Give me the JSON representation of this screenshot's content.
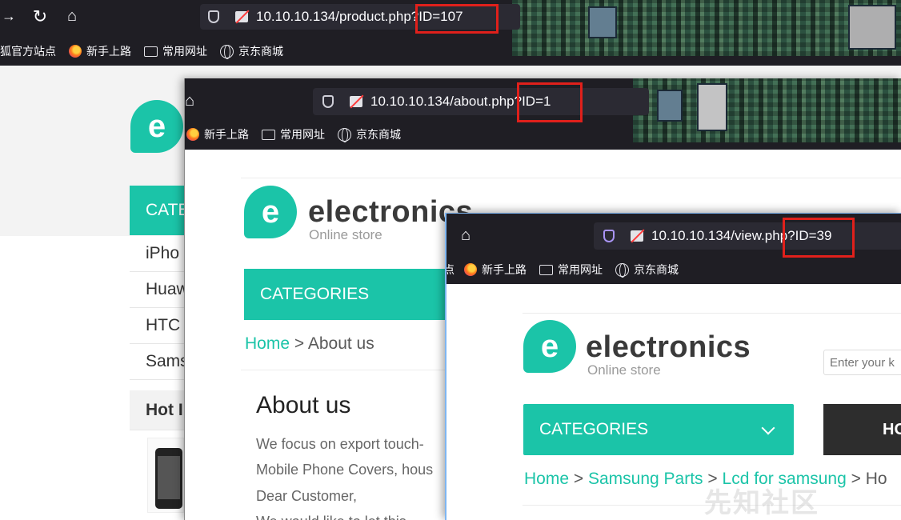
{
  "window1": {
    "url_host": "10.10.10.134/product.ph",
    "url_query": "p?ID=107",
    "bookmarks": [
      "狐官方站点",
      "新手上路",
      "常用网址",
      "京东商城"
    ],
    "sidebar": {
      "categories_label": "CATE",
      "items": [
        "iPho",
        "Huaw",
        "HTC",
        "Sams"
      ],
      "hot_label": "Hot I"
    }
  },
  "window2": {
    "url_host": "10.10.10.134/about.ph",
    "url_query": "p?ID=1",
    "bookmarks": [
      "新手上路",
      "常用网址",
      "京东商城"
    ],
    "logo": {
      "letter": "e",
      "brand": "electronics",
      "tagline": "Online store"
    },
    "categories_label": "CATEGORIES",
    "breadcrumb": {
      "home": "Home",
      "sep": ">",
      "current": "About us"
    },
    "heading": "About us",
    "paragraph_lines": [
      "We focus on export touch-",
      "Mobile Phone Covers, hous",
      "Dear Customer,",
      "We would like to let this"
    ]
  },
  "window3": {
    "url_host": "10.10.10.134/view.ph",
    "url_query": "p?ID=39",
    "bookmarks": [
      "点",
      "新手上路",
      "常用网址",
      "京东商城"
    ],
    "logo": {
      "letter": "e",
      "brand": "electronics",
      "tagline": "Online store"
    },
    "search_placeholder": "Enter your k",
    "categories_label": "CATEGORIES",
    "dark_button_label": "HO",
    "breadcrumb": {
      "home": "Home",
      "sep1": ">",
      "level1": "Samsung Parts",
      "sep2": ">",
      "level2": "Lcd for samsung",
      "sep3": ">",
      "tail": "Ho"
    }
  },
  "watermark": "先知社区",
  "colors": {
    "accent": "#1bc4a8",
    "chrome": "#1f1e24",
    "highlight": "#e0201b"
  }
}
